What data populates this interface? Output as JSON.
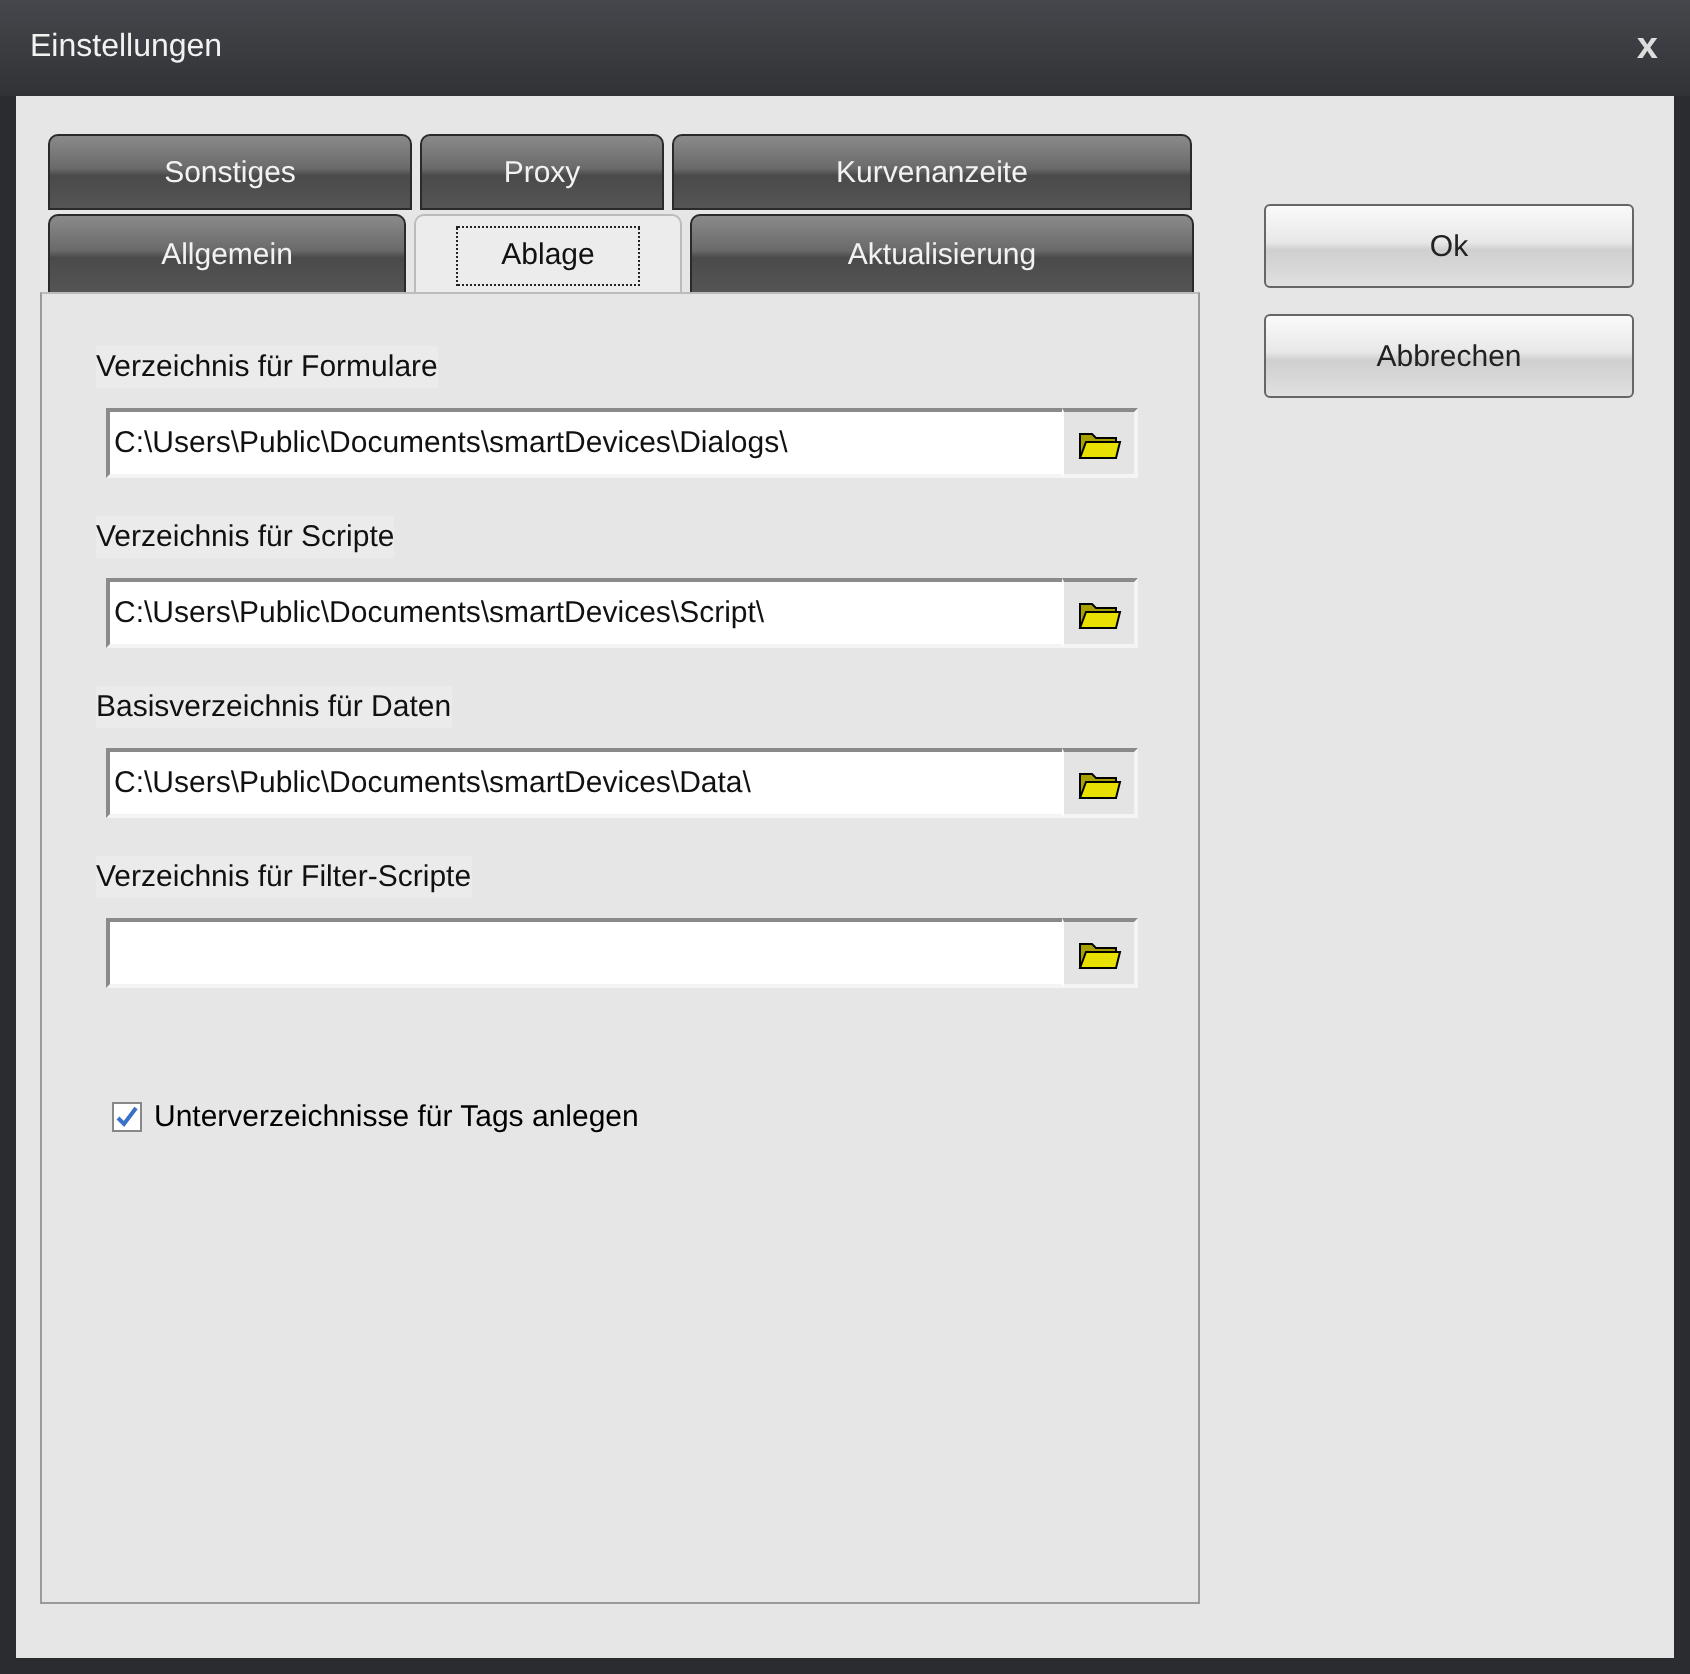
{
  "window": {
    "title": "Einstellungen",
    "close": "x"
  },
  "tab_rows": [
    {
      "tabs": [
        {
          "label": "Sonstiges",
          "selected": false
        },
        {
          "label": "Proxy",
          "selected": false
        },
        {
          "label": "Kurvenanzeite",
          "selected": false
        }
      ]
    },
    {
      "tabs": [
        {
          "label": "Allgemein",
          "selected": false
        },
        {
          "label": "Ablage",
          "selected": true
        },
        {
          "label": "Aktualisierung",
          "selected": false
        }
      ]
    }
  ],
  "fields": [
    {
      "label": "Verzeichnis für Formulare",
      "value": "C:\\Users\\Public\\Documents\\smartDevices\\Dialogs\\"
    },
    {
      "label": "Verzeichnis für Scripte",
      "value": "C:\\Users\\Public\\Documents\\smartDevices\\Script\\"
    },
    {
      "label": "Basisverzeichnis für Daten",
      "value": "C:\\Users\\Public\\Documents\\smartDevices\\Data\\"
    },
    {
      "label": "Verzeichnis für Filter-Scripte"
    }
  ],
  "checkbox": {
    "label": "Unterverzeichnisse für Tags anlegen",
    "checked": true
  },
  "buttons": [
    "Ok",
    "Abbrechen"
  ]
}
